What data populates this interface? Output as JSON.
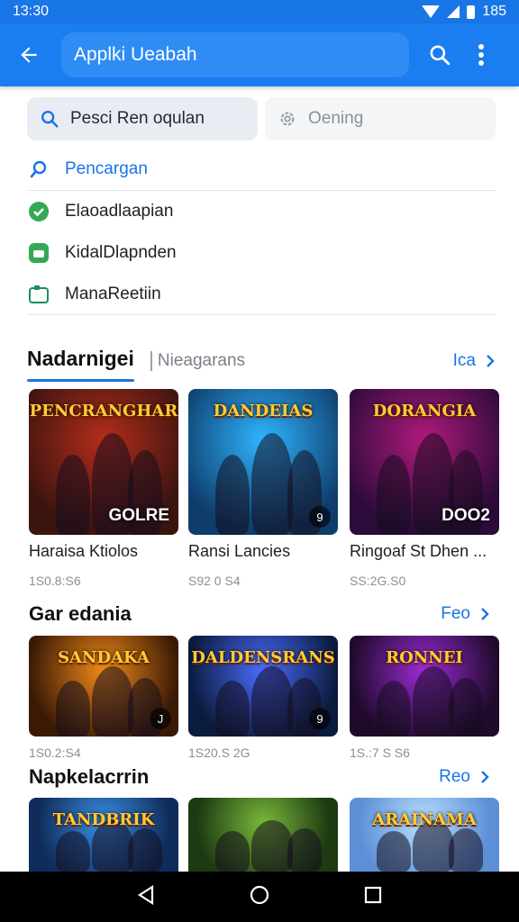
{
  "status": {
    "time": "13:30",
    "battery": "185"
  },
  "appbar": {
    "title": "Applki Ueabah"
  },
  "segments": [
    {
      "label": "Pesci Ren oqulan",
      "active": true
    },
    {
      "label": "Oening",
      "active": false
    }
  ],
  "menu": [
    {
      "label": "Pencargan",
      "icon": "search-icon"
    },
    {
      "label": "Elaoadlaapian",
      "icon": "check-badge-icon"
    },
    {
      "label": "KidalDlapnden",
      "icon": "app-icon"
    },
    {
      "label": "ManaReetiin",
      "icon": "folder-icon"
    }
  ],
  "tabs": {
    "active": "Nadarnigei",
    "inactive": "Nieagarans",
    "see_more": "Ica"
  },
  "sections": [
    {
      "title": "",
      "items": [
        {
          "art_title": "PENCRANGHAR",
          "name": "Haraisa Ktiolos",
          "meta": "1S0.8:S6",
          "corner": "GOLRE",
          "colors": [
            "#3b1410",
            "#b32d1a"
          ]
        },
        {
          "art_title": "DANDEIAS",
          "name": "Ransi Lancies",
          "meta": "S92 0 S4",
          "corner": "9",
          "colors": [
            "#0f3d6b",
            "#2fb5ff"
          ]
        },
        {
          "art_title": "DORANGIA",
          "name": "Ringoaf St Dhen ...",
          "meta": "SS:2G.S0",
          "corner": "DOO2",
          "colors": [
            "#2b0b3a",
            "#b0197d"
          ]
        }
      ]
    },
    {
      "title": "Gar edania",
      "see_more": "Feo",
      "items": [
        {
          "art_title": "SANDAKA",
          "meta": "1S0.2:S4",
          "corner": "J",
          "colors": [
            "#3b1a05",
            "#f08a1a"
          ]
        },
        {
          "art_title": "DALDENSRANS",
          "meta": "1S20.S 2G",
          "corner": "9",
          "colors": [
            "#0b1b3d",
            "#4a6cff"
          ]
        },
        {
          "art_title": "RONNEI",
          "meta": "1S.:7 S S6",
          "corner": "",
          "colors": [
            "#1f0a2b",
            "#9c2bd6"
          ]
        }
      ]
    },
    {
      "title": "Napkelacrrin",
      "see_more": "Reo",
      "items": [
        {
          "art_title": "TANDBRIK",
          "colors": [
            "#0f2c5a",
            "#3a8fe6"
          ]
        },
        {
          "art_title": "",
          "colors": [
            "#1d3a12",
            "#7ab83a"
          ]
        },
        {
          "art_title": "ARAINAMA",
          "colors": [
            "#5c8fd6",
            "#b8e0ff"
          ]
        }
      ]
    }
  ],
  "accent": "#1a7df0"
}
